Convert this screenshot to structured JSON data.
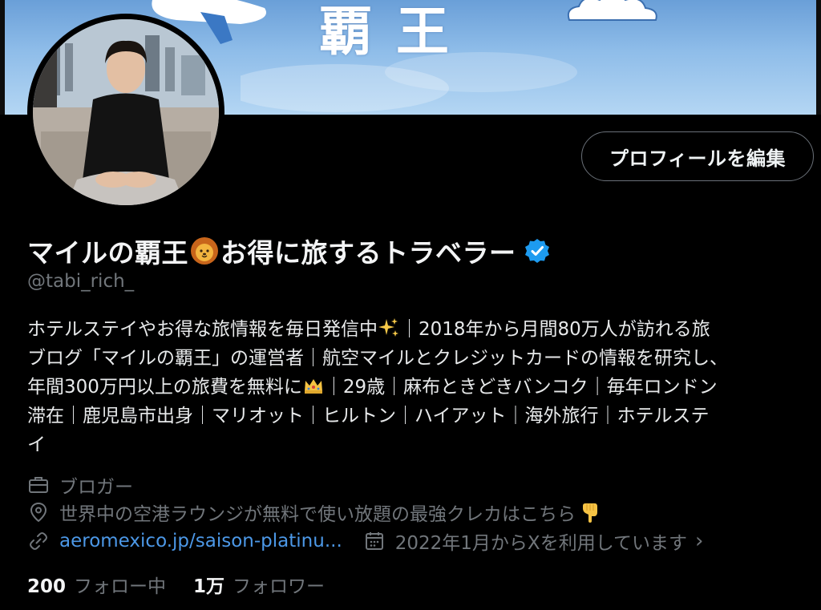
{
  "banner": {
    "text": "覇王"
  },
  "actions": {
    "edit_profile": "プロフィールを編集"
  },
  "profile": {
    "name_part1": "マイルの覇王",
    "name_part2": "お得に旅するトラベラー",
    "handle": "@tabi_rich_",
    "verified": true
  },
  "bio": {
    "line1a": "ホテルステイやお得な旅情報を毎日発信中",
    "line1b": "｜2018年から月間80万人が訪れる旅",
    "line2": "ブログ「マイルの覇王」の運営者｜航空マイルとクレジットカードの情報を研究し、",
    "line3a": "年間300万円以上の旅費を無料に",
    "line3b": "｜29歳｜麻布ときどきバンコク｜毎年ロンドン",
    "line4": "滞在｜鹿児島市出身｜マリオット｜ヒルトン｜ハイアット｜海外旅行｜ホテルステ",
    "line5": "イ"
  },
  "meta": {
    "profession": "ブロガー",
    "location": "世界中の空港ラウンジが無料で使い放題の最強クレカはこちら",
    "link": "aeromexico.jp/saison-platinu...",
    "joined": "2022年1月からXを利用しています",
    "chevron": "›"
  },
  "stats": {
    "following_count": "200",
    "following_label": "フォロー中",
    "followers_count": "1万",
    "followers_label": "フォロワー"
  },
  "colors": {
    "background": "#000000",
    "text": "#e7e9ea",
    "secondary_text": "#71767b",
    "link": "#4c98e7",
    "verified": "#1d9bf0"
  },
  "icons": {
    "verified": "verified-badge-icon",
    "lion": "lion-face-icon",
    "sparkles": "sparkles-icon",
    "crown": "crown-icon",
    "pointing_down": "backhand-index-pointing-down-icon",
    "briefcase": "briefcase-icon",
    "location": "location-pin-icon",
    "link": "link-icon",
    "calendar": "calendar-icon"
  }
}
